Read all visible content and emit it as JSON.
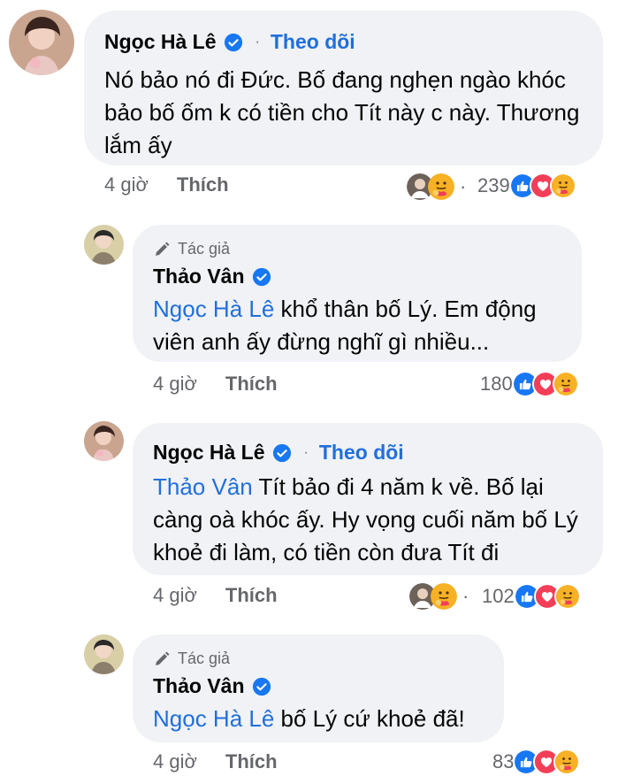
{
  "comments": [
    {
      "name": "Ngọc Hà Lê",
      "follow": "Theo dõi",
      "dot": "·",
      "text": "Nó bảo nó đi Đức. Bố đang nghẹn ngào khóc bảo bố ốm k có tiền cho Tít này c này. Thương lắm ấy",
      "time": "4 giờ",
      "like": "Thích",
      "reaction_count": "239",
      "lead_dot": "·"
    },
    {
      "author_badge": "Tác giả",
      "name": "Thảo Vân",
      "mention": "Ngọc Hà Lê",
      "text": " khổ thân bố Lý. Em động viên anh ấy đừng nghĩ gì nhiều...",
      "time": "4 giờ",
      "like": "Thích",
      "reaction_count": "180"
    },
    {
      "name": "Ngọc Hà Lê",
      "follow": "Theo dõi",
      "dot": "·",
      "mention": "Thảo Vân",
      "text": " Tít bảo đi 4 năm k về. Bố lại càng oà khóc ấy. Hy vọng cuối năm bố Lý khoẻ đi làm, có tiền còn đưa Tít đi",
      "time": "4 giờ",
      "like": "Thích",
      "reaction_count": "102",
      "lead_dot": "·"
    },
    {
      "author_badge": "Tác giả",
      "name": "Thảo Vân",
      "mention": "Ngọc Hà Lê",
      "text": " bố Lý cứ khoẻ đã!",
      "time": "4 giờ",
      "like": "Thích",
      "reaction_count": "83"
    }
  ],
  "colors": {
    "bubble": "#f0f2f5",
    "link": "#216fdb",
    "meta": "#65676b",
    "like_blue": "#1877f2",
    "love_red": "#f33e58",
    "care_yellow": "#f7b125"
  }
}
